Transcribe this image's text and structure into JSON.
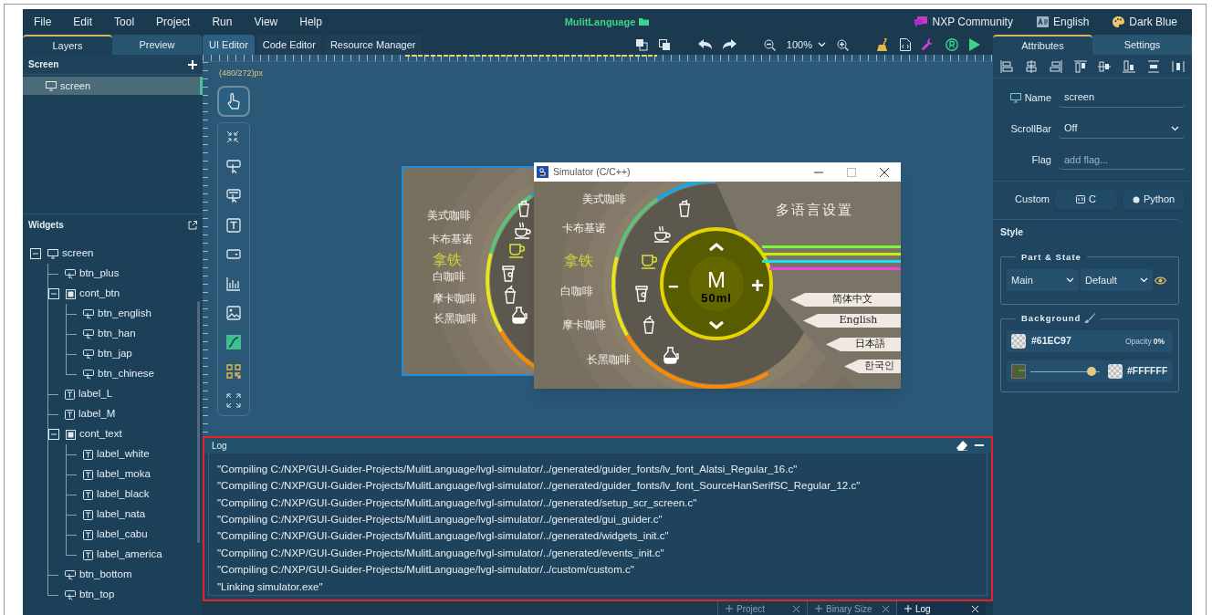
{
  "menu": [
    "File",
    "Edit",
    "Tool",
    "Project",
    "Run",
    "View",
    "Help"
  ],
  "project_title": "MulitLanguage",
  "top_links": [
    {
      "kind": "community",
      "label": "NXP Community"
    },
    {
      "kind": "language",
      "label": "English"
    },
    {
      "kind": "theme",
      "label": "Dark Blue"
    }
  ],
  "left_tabs": [
    {
      "label": "Layers",
      "selected": true
    },
    {
      "label": "Preview",
      "selected": false
    }
  ],
  "editor_tabs": [
    {
      "label": "UI Editor",
      "selected": true
    },
    {
      "label": "Code Editor",
      "selected": false
    },
    {
      "label": "Resource Manager",
      "selected": false
    }
  ],
  "toolbar": {
    "zoom": "100%"
  },
  "right_tabs": [
    {
      "label": "Attributes",
      "selected": true
    },
    {
      "label": "Settings",
      "selected": false
    }
  ],
  "screen_panel": {
    "title": "Screen",
    "items": [
      {
        "label": "screen",
        "selected": true
      }
    ]
  },
  "widgets": {
    "title": "Widgets",
    "tree": [
      {
        "label": "screen",
        "kind": "screen",
        "expanded": true,
        "children": [
          {
            "label": "btn_plus",
            "kind": "button"
          },
          {
            "label": "cont_btn",
            "kind": "container",
            "expanded": true,
            "children": [
              {
                "label": "btn_english",
                "kind": "button"
              },
              {
                "label": "btn_han",
                "kind": "button"
              },
              {
                "label": "btn_jap",
                "kind": "button"
              },
              {
                "label": "btn_chinese",
                "kind": "button"
              }
            ]
          },
          {
            "label": "label_L",
            "kind": "label"
          },
          {
            "label": "label_M",
            "kind": "label"
          },
          {
            "label": "cont_text",
            "kind": "container",
            "expanded": true,
            "children": [
              {
                "label": "label_white",
                "kind": "label"
              },
              {
                "label": "label_moka",
                "kind": "label"
              },
              {
                "label": "label_black",
                "kind": "label"
              },
              {
                "label": "label_nata",
                "kind": "label"
              },
              {
                "label": "label_cabu",
                "kind": "label"
              },
              {
                "label": "label_america",
                "kind": "label"
              }
            ]
          },
          {
            "label": "btn_bottom",
            "kind": "button"
          },
          {
            "label": "btn_top",
            "kind": "button"
          }
        ]
      }
    ]
  },
  "canvas": {
    "size": "(480/272)px",
    "preview": {
      "labels": [
        {
          "text": "美式咖啡",
          "selected": false
        },
        {
          "text": "卡布基诺",
          "selected": false
        },
        {
          "text": "拿铁",
          "selected": true
        },
        {
          "text": "白咖啡",
          "selected": false
        },
        {
          "text": "摩卡咖啡",
          "selected": false
        },
        {
          "text": "长黑咖啡",
          "selected": false
        }
      ]
    },
    "simulator": {
      "title": "Simulator (C/C++)",
      "labels": [
        {
          "text": "美式咖啡",
          "selected": false
        },
        {
          "text": "卡布基诺",
          "selected": false
        },
        {
          "text": "拿铁",
          "selected": true
        },
        {
          "text": "白咖啡",
          "selected": false
        },
        {
          "text": "摩卡咖啡",
          "selected": false
        },
        {
          "text": "长黑咖啡",
          "selected": false
        }
      ],
      "heading": "多语言设置",
      "dial": {
        "size": "M",
        "volume": "50ml",
        "minus": "−",
        "plus": "+"
      },
      "languages": [
        "简体中文",
        "English",
        "日本語",
        "한국인"
      ]
    }
  },
  "log": {
    "title": "Log",
    "lines": [
      "\"Compiling C:/NXP/GUI-Guider-Projects/MulitLanguage/lvgl-simulator/../generated/guider_fonts/lv_font_Alatsi_Regular_16.c\"",
      "\"Compiling C:/NXP/GUI-Guider-Projects/MulitLanguage/lvgl-simulator/../generated/guider_fonts/lv_font_SourceHanSerifSC_Regular_12.c\"",
      "\"Compiling C:/NXP/GUI-Guider-Projects/MulitLanguage/lvgl-simulator/../generated/setup_scr_screen.c\"",
      "\"Compiling C:/NXP/GUI-Guider-Projects/MulitLanguage/lvgl-simulator/../generated/gui_guider.c\"",
      "\"Compiling C:/NXP/GUI-Guider-Projects/MulitLanguage/lvgl-simulator/../generated/widgets_init.c\"",
      "\"Compiling C:/NXP/GUI-Guider-Projects/MulitLanguage/lvgl-simulator/../generated/events_init.c\"",
      "\"Compiling C:/NXP/GUI-Guider-Projects/MulitLanguage/lvgl-simulator/../custom/custom.c\"",
      "\"Linking simulator.exe\""
    ]
  },
  "bottom_tabs": [
    {
      "label": "Project",
      "selected": false
    },
    {
      "label": "Binary Size",
      "selected": false
    },
    {
      "label": "Log",
      "selected": true
    }
  ],
  "attributes": {
    "name_label": "Name",
    "name": "screen",
    "scrollbar_label": "ScrollBar",
    "scrollbar": "Off",
    "flag_label": "Flag",
    "flag_placeholder": "add flag...",
    "custom_label": "Custom",
    "custom_buttons": [
      {
        "kind": "c",
        "label": "C"
      },
      {
        "kind": "python",
        "label": "Python"
      }
    ]
  },
  "style": {
    "title": "Style",
    "part_state_title": "Part & State",
    "part": "Main",
    "state": "Default",
    "background_title": "Background",
    "background_value": "#61EC97",
    "opacity_label": "Opacity",
    "opacity": "0%",
    "gradient": {
      "level": 0.88,
      "end_value": "#FFFFFF"
    }
  }
}
